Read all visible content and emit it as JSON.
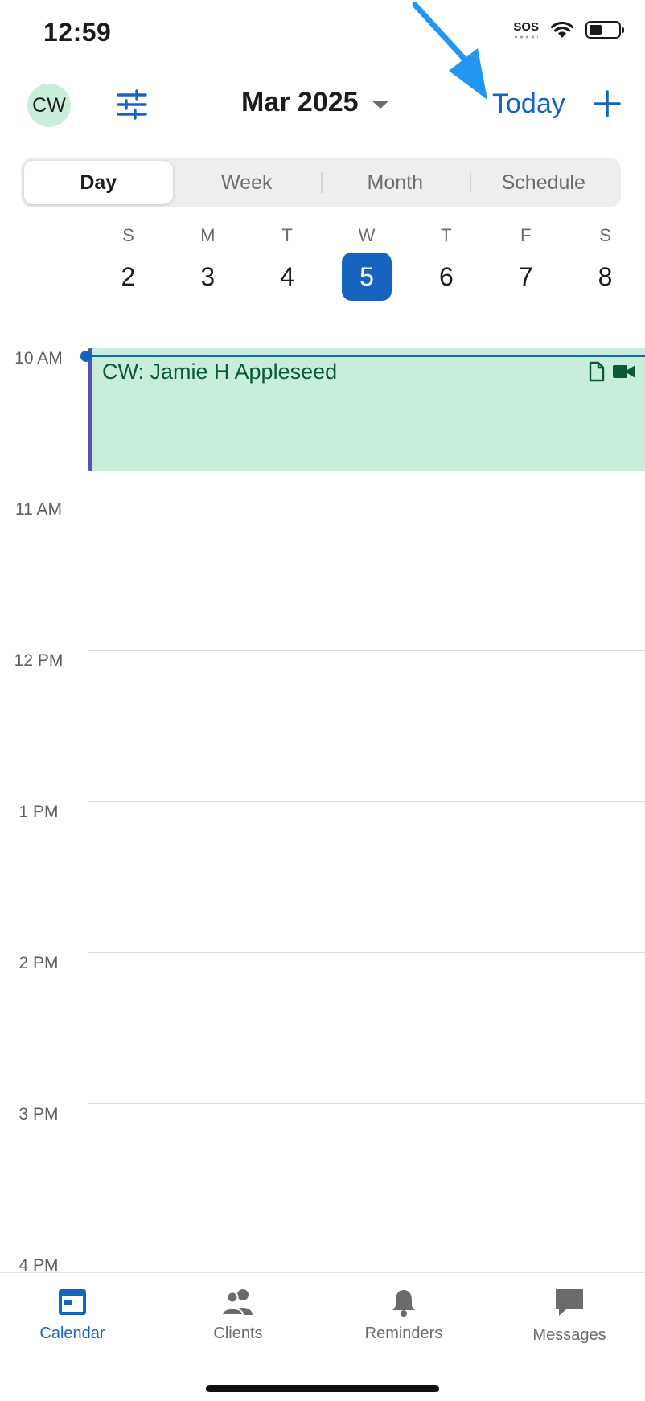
{
  "status_bar": {
    "time": "12:59",
    "sos": "SOS",
    "battery_level": 0.45
  },
  "header": {
    "avatar_initials": "CW",
    "month_title": "Mar 2025",
    "today_label": "Today"
  },
  "view_tabs": [
    {
      "label": "Day",
      "active": true
    },
    {
      "label": "Week",
      "active": false
    },
    {
      "label": "Month",
      "active": false
    },
    {
      "label": "Schedule",
      "active": false
    }
  ],
  "week": [
    {
      "dow": "S",
      "day": "2"
    },
    {
      "dow": "M",
      "day": "3"
    },
    {
      "dow": "T",
      "day": "4"
    },
    {
      "dow": "W",
      "day": "5",
      "selected": true
    },
    {
      "dow": "T",
      "day": "6"
    },
    {
      "dow": "F",
      "day": "7"
    },
    {
      "dow": "S",
      "day": "8"
    }
  ],
  "hours": [
    "10 AM",
    "11 AM",
    "12 PM",
    "1 PM",
    "2 PM",
    "3 PM",
    "4 PM"
  ],
  "event": {
    "title": "CW: Jamie H Appleseed",
    "icons": [
      "document-icon",
      "video-camera-icon"
    ]
  },
  "tab_bar": [
    {
      "label": "Calendar",
      "icon": "calendar-icon",
      "active": true
    },
    {
      "label": "Clients",
      "icon": "people-icon",
      "active": false
    },
    {
      "label": "Reminders",
      "icon": "bell-icon",
      "active": false
    },
    {
      "label": "Messages",
      "icon": "chat-bubble-icon",
      "active": false
    }
  ],
  "colors": {
    "accent": "#1565c0",
    "event_bg": "#c6eedb",
    "event_bar": "#5450b4",
    "avatar_bg": "#c8eed9",
    "annotation_arrow": "#2196f3"
  }
}
